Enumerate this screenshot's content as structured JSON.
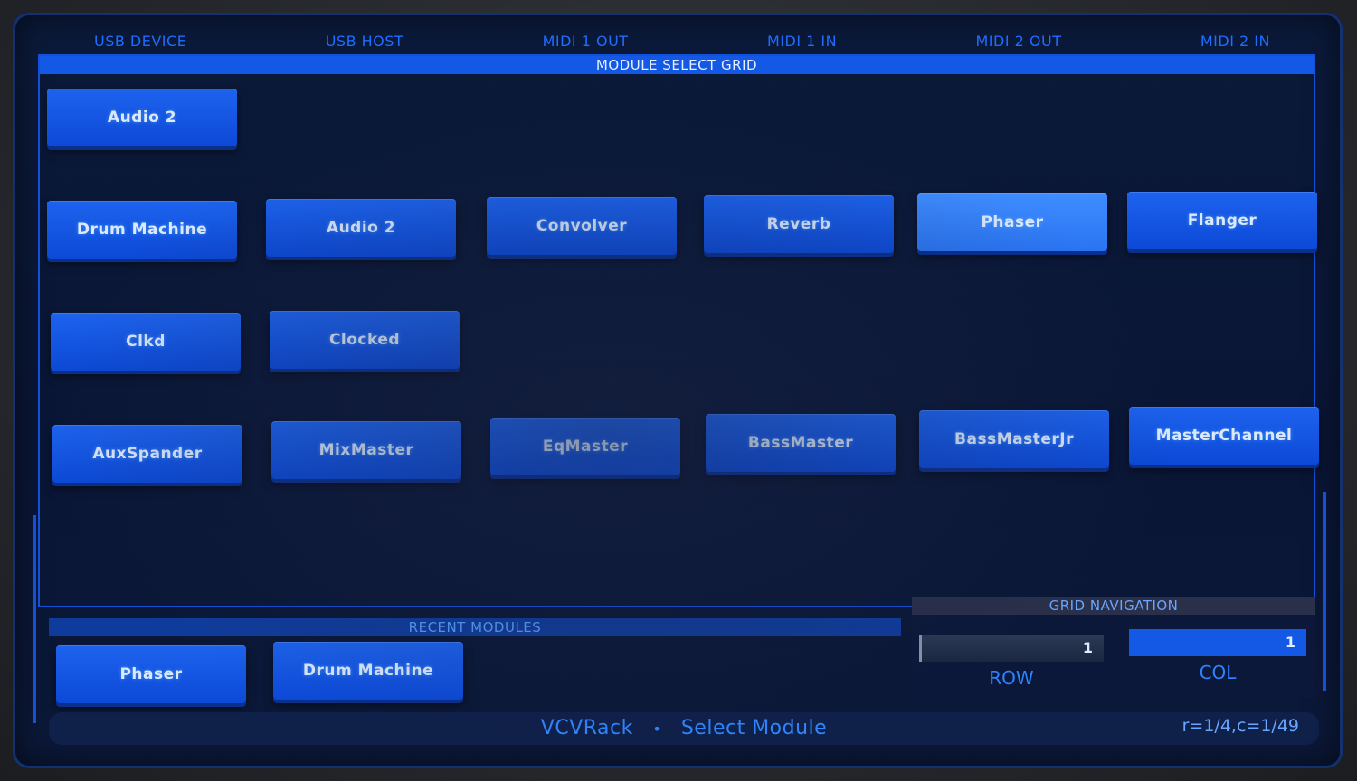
{
  "top_ports": [
    "USB DEVICE",
    "USB HOST",
    "MIDI 1 OUT",
    "MIDI 1 IN",
    "MIDI 2 OUT",
    "MIDI 2 IN"
  ],
  "grid": {
    "title": "MODULE SELECT GRID",
    "rows": [
      [
        "Audio 2"
      ],
      [
        "Drum Machine",
        "Audio 2",
        "Convolver",
        "Reverb",
        "Phaser",
        "Flanger"
      ],
      [
        "Clkd",
        "Clocked"
      ],
      [
        "AuxSpander",
        "MixMaster",
        "EqMaster",
        "BassMaster",
        "BassMasterJr",
        "MasterChannel"
      ]
    ],
    "selected": "Phaser"
  },
  "recent": {
    "title": "RECENT MODULES",
    "items": [
      "Phaser",
      "Drum Machine"
    ]
  },
  "navigation": {
    "title": "GRID NAVIGATION",
    "row_value": "1",
    "row_label": "ROW",
    "col_value": "1",
    "col_label": "COL"
  },
  "status": {
    "app": "VCVRack",
    "separator": "•",
    "action": "Select Module",
    "position": "r=1/4,c=1/49"
  },
  "colors": {
    "accent": "#1458e6",
    "button": "#0c49d6",
    "button_active": "#2a74f2",
    "background": "#0a1636"
  }
}
